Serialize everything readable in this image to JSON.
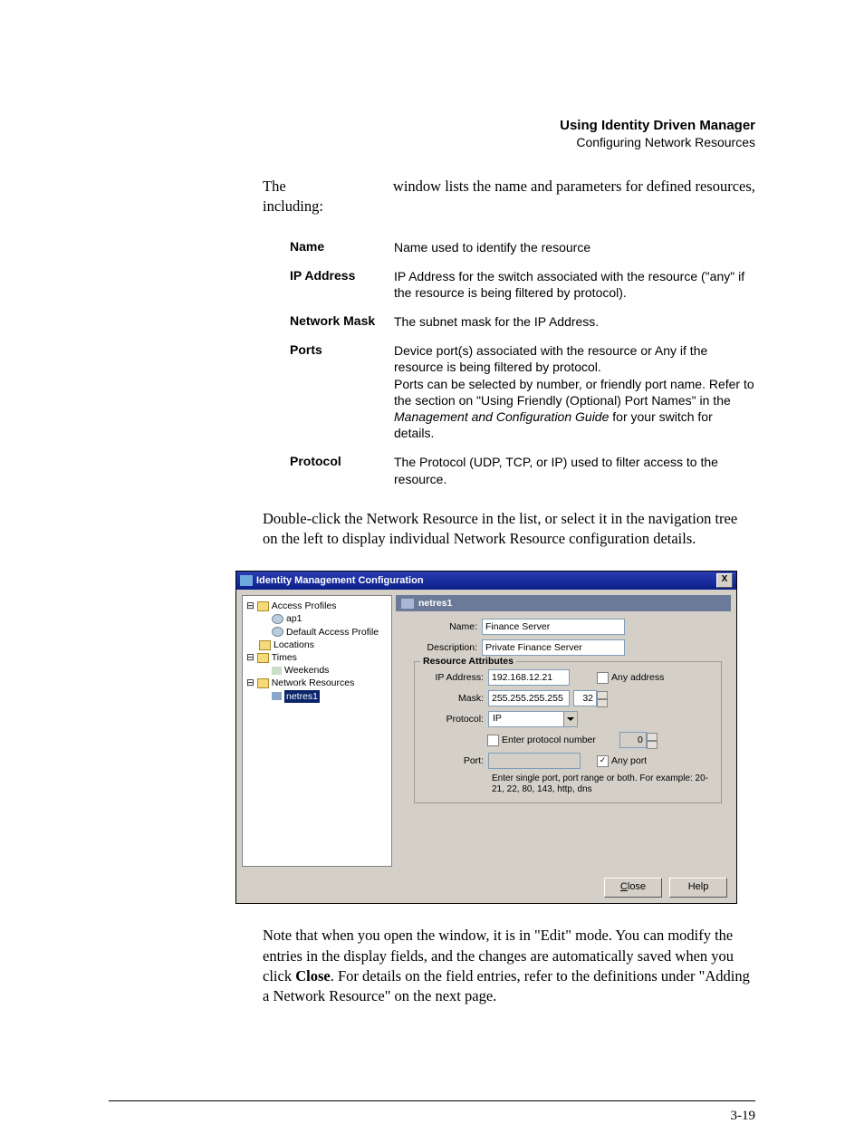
{
  "header": {
    "title": "Using Identity Driven Manager",
    "subtitle": "Configuring Network Resources"
  },
  "intro": {
    "line1_a": "The ",
    "line1_b": " window lists the name and parameters for defined resources, including:"
  },
  "defs": [
    {
      "term": "Name",
      "desc": "Name used to identify the resource"
    },
    {
      "term": "IP Address",
      "desc": "IP Address for the switch associated with the resource (\"any\" if the resource is being filtered by protocol)."
    },
    {
      "term": "Network Mask",
      "desc": "The subnet mask for the IP Address."
    },
    {
      "term": "Ports",
      "desc": "Device port(s) associated with the resource or Any if the resource is being filtered by protocol.\nPorts can be selected by number, or friendly port name. Refer to the section on \"Using Friendly (Optional) Port Names\" in the ",
      "italic": "Management and Configuration Guide",
      "tail": " for your switch for details."
    },
    {
      "term": "Protocol",
      "desc": "The Protocol (UDP, TCP, or IP) used to filter access to the resource."
    }
  ],
  "mid_para": "Double-click the Network Resource in the list, or select it in the navigation tree on the left to display individual Network Resource configuration details.",
  "screenshot": {
    "title": "Identity Management Configuration",
    "tree": {
      "access_profiles": "Access Profiles",
      "ap1": "ap1",
      "default_ap": "Default Access Profile",
      "locations": "Locations",
      "times": "Times",
      "weekends": "Weekends",
      "network_resources": "Network Resources",
      "netres1": "netres1"
    },
    "panel_title": "netres1",
    "form": {
      "name_label": "Name:",
      "name_value": "Finance Server",
      "desc_label": "Description:",
      "desc_value": "Private Finance Server",
      "fieldset_legend": "Resource Attributes",
      "ip_label": "IP Address:",
      "ip_value": "192.168.12.21",
      "any_address": "Any address",
      "mask_label": "Mask:",
      "mask_value": "255.255.255.255",
      "mask_bits": "32",
      "protocol_label": "Protocol:",
      "protocol_value": "IP",
      "enter_proto": "Enter protocol number",
      "proto_num": "0",
      "port_label": "Port:",
      "port_value": "",
      "any_port": "Any port",
      "port_hint": "Enter single port, port range or both. For example: 20-21, 22, 80, 143, http, dns"
    },
    "buttons": {
      "close": "Close",
      "help": "Help"
    },
    "close_x": "X"
  },
  "after_para_1": "Note that when you open the window, it is in \"Edit\" mode. You can modify the entries in the display fields, and the changes are automatically saved when you click ",
  "close_bold": "Close",
  "after_para_2": ". For details on the field entries, refer to the definitions under \"Adding a Network Resource\" on the next page.",
  "page_number": "3-19"
}
